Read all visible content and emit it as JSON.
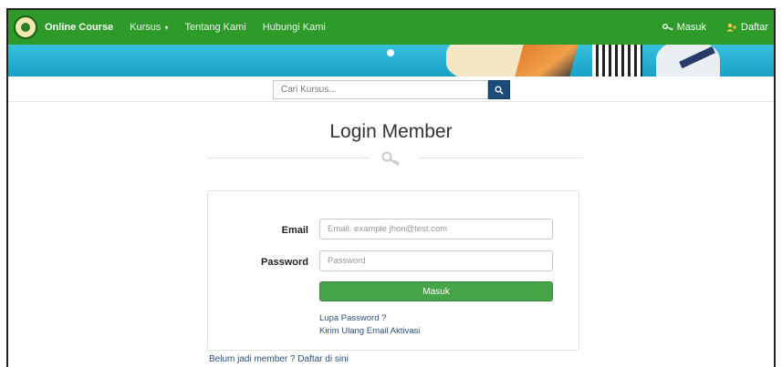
{
  "navbar": {
    "brand": "Online Course",
    "items": [
      {
        "label": "Kursus",
        "caret": "▾"
      },
      {
        "label": "Tentang Kami"
      },
      {
        "label": "Hubungi Kami"
      }
    ],
    "right": {
      "login_label": "Masuk",
      "register_label": "Daftar"
    }
  },
  "search": {
    "placeholder": "Cari Kursus..."
  },
  "page": {
    "title": "Login Member"
  },
  "form": {
    "email_label": "Email",
    "email_placeholder": "Email. example jhon@test.com",
    "password_label": "Password",
    "password_placeholder": "Password",
    "submit_label": "Masuk",
    "forgot_link": "Lupa Password ?",
    "resend_link": "Kirim Ulang Email Aktivasi"
  },
  "footer": {
    "register_prompt": "Belum jadi member ? Daftar di sini"
  },
  "colors": {
    "navbar": "#2e9a2a",
    "banner": "#1aa1c8",
    "search_button": "#1d4b7a",
    "submit_button": "#47a447",
    "link": "#2a4f7a"
  },
  "icons": {
    "login": "key-icon",
    "register": "user-plus-icon",
    "search": "search-icon",
    "divider": "key-icon"
  }
}
